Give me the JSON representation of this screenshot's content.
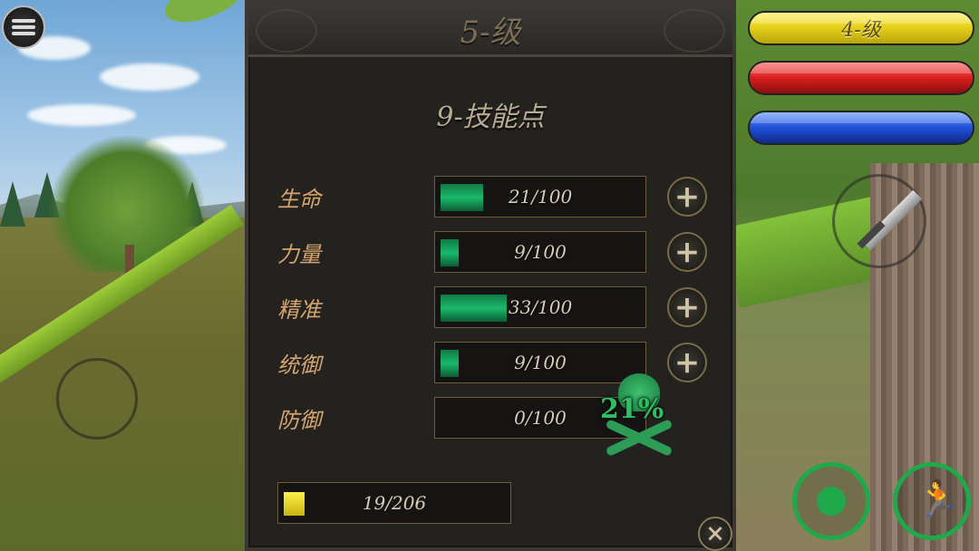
{
  "window_title": "5-级",
  "skill_points": "9-技能点",
  "stats": [
    {
      "label": "生命",
      "value": "21/100",
      "progress": 0.21
    },
    {
      "label": "力量",
      "value": "9/100",
      "progress": 0.09
    },
    {
      "label": "精准",
      "value": "33/100",
      "progress": 0.33
    },
    {
      "label": "统御",
      "value": "9/100",
      "progress": 0.09
    },
    {
      "label": "防御",
      "value": "0/100",
      "progress": 0.0
    }
  ],
  "experience": {
    "value": "19/206",
    "progress": 0.092
  },
  "hud": {
    "level_label": "4-级",
    "health_fill": 0.9,
    "mana_fill": 1.0,
    "poison_pct": "21%"
  },
  "icons": {
    "menu": "menu-icon",
    "plus": "+",
    "close": "×",
    "sword": "sword-icon",
    "target": "target-icon",
    "run": "run-icon",
    "poison": "skull-crossbones-icon"
  },
  "colors": {
    "stat_fill": "#1bb86a",
    "xp_fill": "#ffef4a",
    "level_bar": "#e6d21a",
    "health_bar": "#d71e1e",
    "mana_bar": "#1f4fd6",
    "label_text": "#d6a56d"
  }
}
